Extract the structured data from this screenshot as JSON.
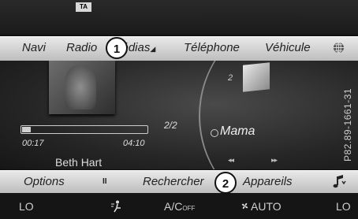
{
  "status": {
    "ta_badge": "TA"
  },
  "top_menu": {
    "items": [
      "Navi",
      "Radio",
      "Médias",
      "Téléphone",
      "Véhicule"
    ],
    "caret": "▲",
    "globe_icon": "globe-icon"
  },
  "callouts": {
    "one": "1",
    "two": "2"
  },
  "player": {
    "track_count": "2/2",
    "track_number": "2",
    "track_title": "Mama",
    "elapsed": "00:17",
    "total": "04:10",
    "progress": 0.07,
    "artist": "Beth Hart",
    "prev_label": "◂◂",
    "next_label": "▸▸"
  },
  "bottom_menu": {
    "options": "Options",
    "pause_icon": "II",
    "search": "Rechercher",
    "devices": "Appareils",
    "note_icon": "music-note-icon"
  },
  "climate": {
    "left_temp": "LO",
    "ac": "A/C",
    "ac_sub": "OFF",
    "auto": "AUTO",
    "right_temp": "LO"
  },
  "side_code": "P82.89-1661-31",
  "colors": {
    "menu_bg": "#d2d2d2",
    "screen_bg": "#1a1a1a",
    "accent": "#ffffff"
  }
}
